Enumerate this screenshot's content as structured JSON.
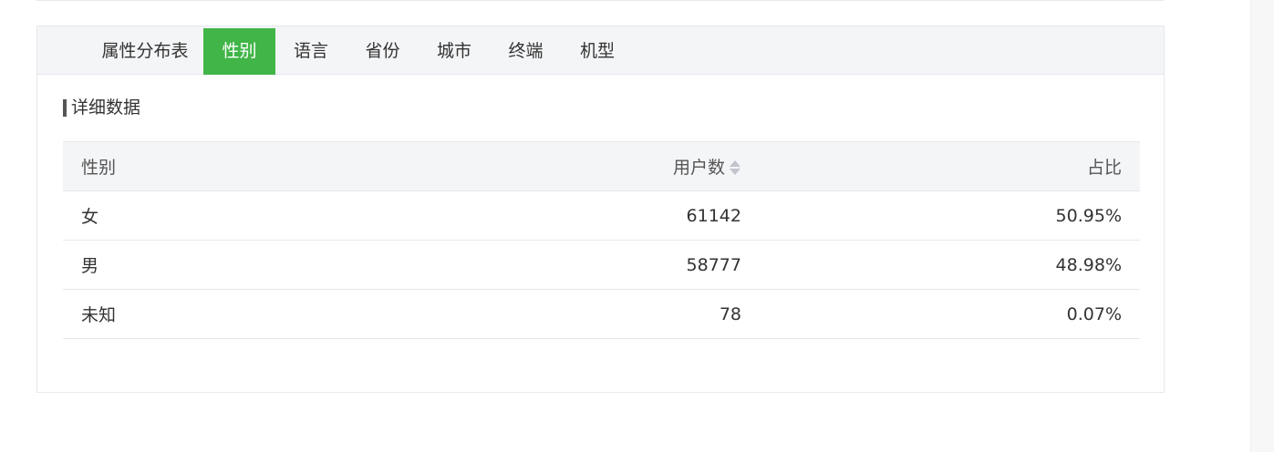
{
  "tabs": [
    {
      "label": "属性分布表",
      "active": false
    },
    {
      "label": "性别",
      "active": true
    },
    {
      "label": "语言",
      "active": false
    },
    {
      "label": "省份",
      "active": false
    },
    {
      "label": "城市",
      "active": false
    },
    {
      "label": "终端",
      "active": false
    },
    {
      "label": "机型",
      "active": false
    }
  ],
  "section": {
    "title": "详细数据"
  },
  "table": {
    "headers": {
      "gender": "性别",
      "users": "用户数",
      "ratio": "占比"
    },
    "sort_icon": "sort-icon",
    "rows": [
      {
        "gender": "女",
        "users": "61142",
        "ratio": "50.95%"
      },
      {
        "gender": "男",
        "users": "58777",
        "ratio": "48.98%"
      },
      {
        "gender": "未知",
        "users": "78",
        "ratio": "0.07%"
      }
    ]
  },
  "colors": {
    "accent": "#41b548",
    "tab_bar_bg": "#f4f5f7",
    "header_bg": "#f4f5f7",
    "border": "#e6e8ec"
  }
}
